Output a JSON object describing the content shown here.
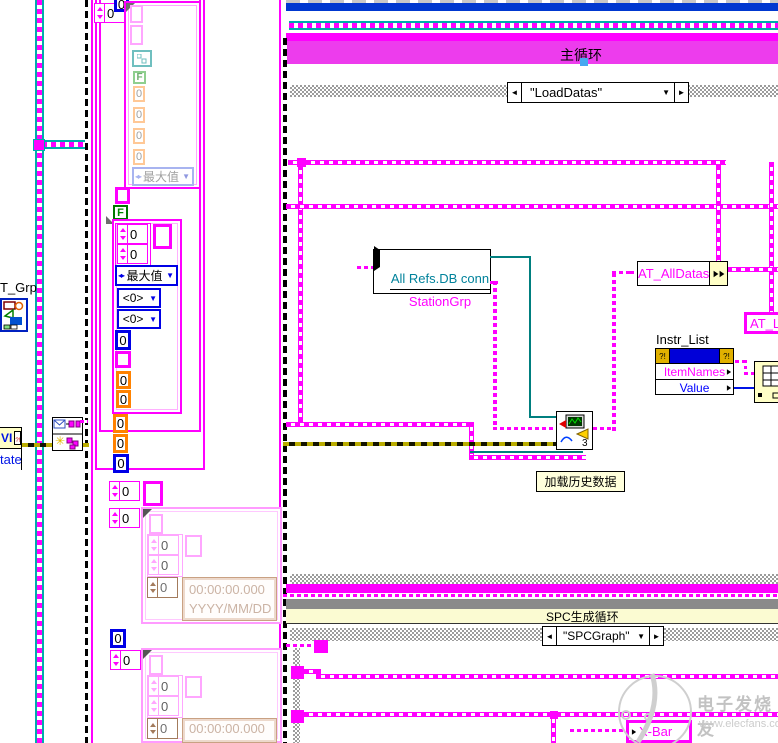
{
  "watermark": {
    "brand": "电子发烧友",
    "site": "www.elecfans.com"
  },
  "glyphs": {
    "arrow_left": "◄",
    "arrow_right": "►",
    "arrow_down": "▼",
    "lr_pair": "◂▸",
    "warn": "?!"
  },
  "left": {
    "t_grp": "T_Grp",
    "vi_node": {
      "title": "VI",
      "state_text": "tate",
      "warn": "?!"
    },
    "top_spin": "0",
    "top_blue": "0",
    "frame1": {
      "zeros": [
        "0",
        "0",
        "0",
        "0"
      ],
      "bool": "F",
      "dropdown": "最大值"
    },
    "bool_const": "F",
    "frame2": {
      "spins": [
        "0",
        "0"
      ],
      "dropdown": "最大值",
      "elems": [
        "<0>",
        "<0>"
      ],
      "blue": "0",
      "oranges": [
        "0",
        "0"
      ]
    },
    "loose": {
      "oranges": [
        "0",
        "0"
      ],
      "blue": "0"
    },
    "mid": {
      "spin1": "0",
      "spin2": "0"
    },
    "frame3": {
      "spins": [
        "0",
        "0"
      ],
      "brown": "0",
      "time": "00:00:00.000",
      "date": "YYYY/MM/DD"
    },
    "low": {
      "blue": "0",
      "spin": "0"
    },
    "frame4": {
      "spins": [
        "0",
        "0"
      ],
      "brown": "0",
      "time": "00:00:00.000"
    }
  },
  "main": {
    "loop_title": "主循环",
    "case_selector": "\"LoadDatas\"",
    "unbundle": {
      "row1": "All Refs.DB conn",
      "row2": "StationGrp"
    },
    "bundle": "AT_AllDatas",
    "local_var": "AT_Lo",
    "prop": {
      "label": "Instr_List",
      "row1": "ItemNames",
      "row2": "Value",
      "warn": "?!"
    },
    "subvi_badge": "3",
    "subvi_caption": "加载历史数据"
  },
  "spc": {
    "band_title": "SPC生成循环",
    "case_selector": "\"SPCGraph\"",
    "ring": "X-Bar"
  }
}
